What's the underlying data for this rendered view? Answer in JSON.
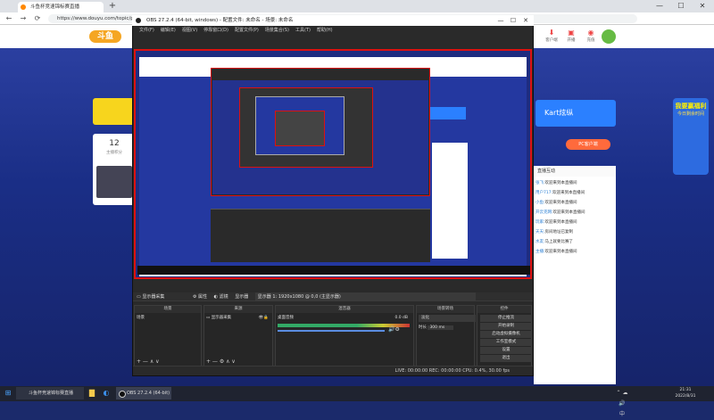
{
  "browser": {
    "tab_title": "斗鱼杯竞速锦标赛直播",
    "new_tab": "+",
    "url": "https://www.douyu.com/topic/pdd...",
    "controls": {
      "back": "←",
      "forward": "→",
      "reload": "⟳"
    },
    "window_buttons": {
      "min": "—",
      "max": "☐",
      "close": "✕"
    }
  },
  "site": {
    "logo_text": "斗鱼",
    "header_icons": [
      "客户端",
      "开播",
      "充值"
    ],
    "left_card": {
      "count": "12",
      "label": "主播积分"
    },
    "kart_banner": "Kart炫纵",
    "pc_button": "PC客户端",
    "promo": {
      "title": "我要赢福利",
      "sub": "今日剩余时间"
    },
    "chat_header": "直播互动",
    "chat_lines": [
      {
        "name": "张飞:",
        "text": "欢迎来到本直播间"
      },
      {
        "name": "用户717:",
        "text": "欢迎来到本直播间"
      },
      {
        "name": "小鱼:",
        "text": "欢迎来到本直播间"
      },
      {
        "name": "开云克网:",
        "text": "欢迎来到本直播间"
      },
      {
        "name": "玩家:",
        "text": "欢迎来到本直播间"
      },
      {
        "name": "天天:",
        "text": "房间地址已复制"
      },
      {
        "name": "水友:",
        "text": "马上就要比赛了"
      },
      {
        "name": "主播:",
        "text": "欢迎来到本直播间"
      }
    ]
  },
  "obs": {
    "title": "OBS 27.2.4 (64-bit, windows) - 配置文件: 未命名 - 场景: 未命名",
    "menu": [
      "文件(F)",
      "编辑(E)",
      "视图(V)",
      "停靠窗口(D)",
      "配置文件(P)",
      "场景集合(S)",
      "工具(T)",
      "帮助(H)"
    ],
    "source_bar": {
      "source_name": "显示器采集",
      "props": "属性",
      "filters": "滤镜",
      "display": "显示器",
      "display_value": "显示器 1: 1920x1080 @ 0,0 (主显示器)"
    },
    "docks": {
      "scenes": {
        "header": "场景",
        "items": [
          "场景"
        ],
        "tools": "+ — ∧ ∨"
      },
      "sources": {
        "header": "来源",
        "items": [
          "显示器采集"
        ],
        "tools": "+ — ⚙ ∧ ∨"
      },
      "mixer": {
        "header": "混音器",
        "track": "桌面音频",
        "level": "0.0 dB"
      },
      "transitions": {
        "header": "场景转场",
        "selected": "淡化",
        "duration_label": "时长",
        "duration": "300 ms"
      },
      "controls": {
        "header": "控件",
        "buttons": [
          "停止推流",
          "开始录制",
          "启动虚拟摄像机",
          "工作室模式",
          "设置",
          "退出"
        ]
      }
    },
    "status": "LIVE: 00:00:00    REC: 00:00:00    CPU: 0.4%, 30.00 fps"
  },
  "taskbar": {
    "search_placeholder": "斗鱼杯竞速锦标赛直播",
    "obs_task": "OBS 27.2.4 (64-bit)",
    "time": "21:31",
    "date": "2022/8/31"
  }
}
